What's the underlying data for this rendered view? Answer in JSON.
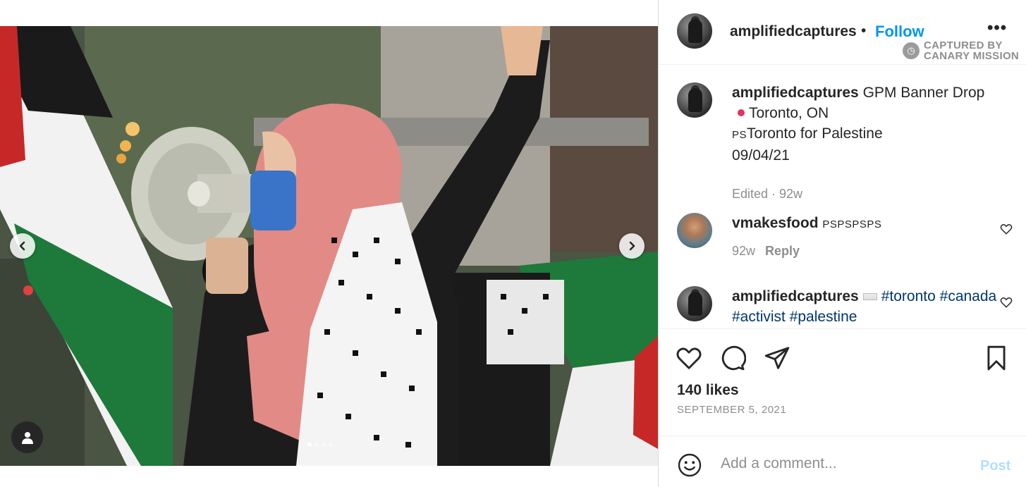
{
  "post": {
    "username": "amplifiedcaptures",
    "separator": "•",
    "follow_label": "Follow",
    "more_label": "•••",
    "watermark": {
      "line1": "CAPTURED BY",
      "line2": "CANARY MISSION"
    }
  },
  "caption": {
    "username": "amplifiedcaptures",
    "title": "GPM Banner Drop",
    "location": "Toronto, ON",
    "org_prefix": "PS",
    "org": "Toronto for Palestine",
    "date": "09/04/21",
    "meta": "Edited · 92w"
  },
  "comments": [
    {
      "username": "vmakesfood",
      "text": "PSPSPSPS",
      "age": "92w",
      "reply_label": "Reply"
    },
    {
      "username": "amplifiedcaptures",
      "hashtags": [
        "#toronto",
        "#canada",
        "#activist",
        "#palestine"
      ]
    }
  ],
  "engagement": {
    "likes": "140 likes",
    "date": "SEPTEMBER 5, 2021"
  },
  "composer": {
    "placeholder": "Add a comment...",
    "post_label": "Post"
  },
  "carousel": {
    "slides": 4,
    "active": 1
  },
  "colors": {
    "follow": "#0095f6",
    "hashtag": "#00376b",
    "muted": "#8e8e8e",
    "post_disabled": "#b2dffc",
    "pin": "#e8315b"
  },
  "icons": [
    "chevron-left-icon",
    "chevron-right-icon",
    "user-tag-icon",
    "heart-icon",
    "comment-icon",
    "share-icon",
    "bookmark-icon",
    "emoji-icon",
    "clock-icon"
  ]
}
